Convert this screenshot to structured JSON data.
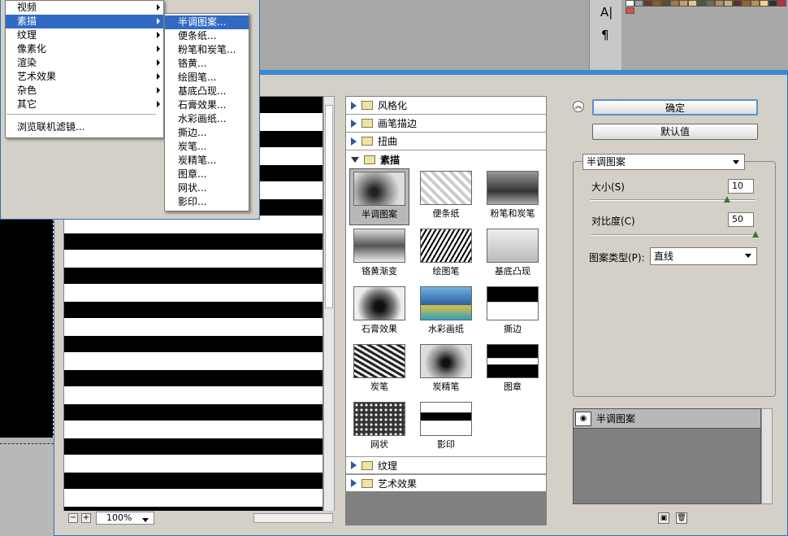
{
  "menu": {
    "items": [
      {
        "label": "视频"
      },
      {
        "label": "素描"
      },
      {
        "label": "纹理"
      },
      {
        "label": "像素化"
      },
      {
        "label": "渲染"
      },
      {
        "label": "艺术效果"
      },
      {
        "label": "杂色"
      },
      {
        "label": "其它"
      }
    ],
    "browse": "浏览联机滤镜..."
  },
  "submenu": {
    "items": [
      "半调图案...",
      "便条纸...",
      "粉笔和炭笔...",
      "铬黄...",
      "绘图笔...",
      "基底凸现...",
      "石膏效果...",
      "水彩画纸...",
      "撕边...",
      "炭笔...",
      "炭精笔...",
      "图章...",
      "网状...",
      "影印..."
    ]
  },
  "preview": {
    "zoom": "100%"
  },
  "gallery": {
    "categories_top": [
      "风格化",
      "画笔描边",
      "扭曲"
    ],
    "open_category": "素描",
    "thumbnails": [
      "半调图案",
      "便条纸",
      "粉笔和炭笔",
      "铬黄渐变",
      "绘图笔",
      "基底凸现",
      "石膏效果",
      "水彩画纸",
      "撕边",
      "炭笔",
      "炭精笔",
      "图章",
      "网状",
      "影印"
    ],
    "categories_bottom": [
      "纹理",
      "艺术效果"
    ]
  },
  "panel": {
    "ok": "确定",
    "default": "默认值",
    "filter": "半调图案",
    "size_label": "大小(S)",
    "size_value": "10",
    "contrast_label": "对比度(C)",
    "contrast_value": "50",
    "pattern_label": "图案类型(P):",
    "pattern_value": "直线",
    "size_level": 0.83,
    "contrast_level": 1.0
  },
  "layers": {
    "row": "半调图案"
  }
}
